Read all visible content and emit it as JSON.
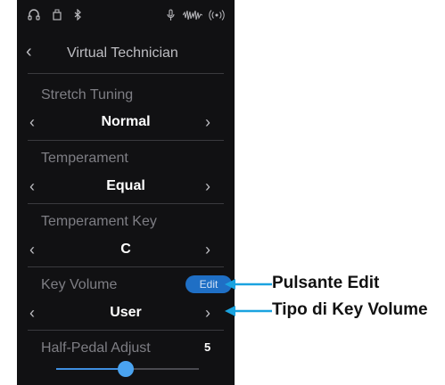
{
  "status_icons": [
    "headphones-icon",
    "usb-icon",
    "bluetooth-icon",
    "microphone-icon",
    "audio-wave-icon",
    "wireless-icon"
  ],
  "header": {
    "back_icon": "chevron-left-icon",
    "title": "Virtual Technician"
  },
  "settings": [
    {
      "label": "Stretch Tuning",
      "value": "Normal"
    },
    {
      "label": "Temperament",
      "value": "Equal"
    },
    {
      "label": "Temperament Key",
      "value": "C"
    },
    {
      "label": "Key Volume",
      "value": "User",
      "button": "Edit"
    },
    {
      "label": "Half-Pedal Adjust",
      "value": "5",
      "slider_level": 0.47
    }
  ],
  "annotations": {
    "edit_button": "Pulsante Edit",
    "key_volume_type": "Tipo di Key Volume"
  },
  "colors": {
    "background": "#111113",
    "accent": "#1f6fc5",
    "slider": "#4aa3f0",
    "callout": "#1aa3e0"
  }
}
